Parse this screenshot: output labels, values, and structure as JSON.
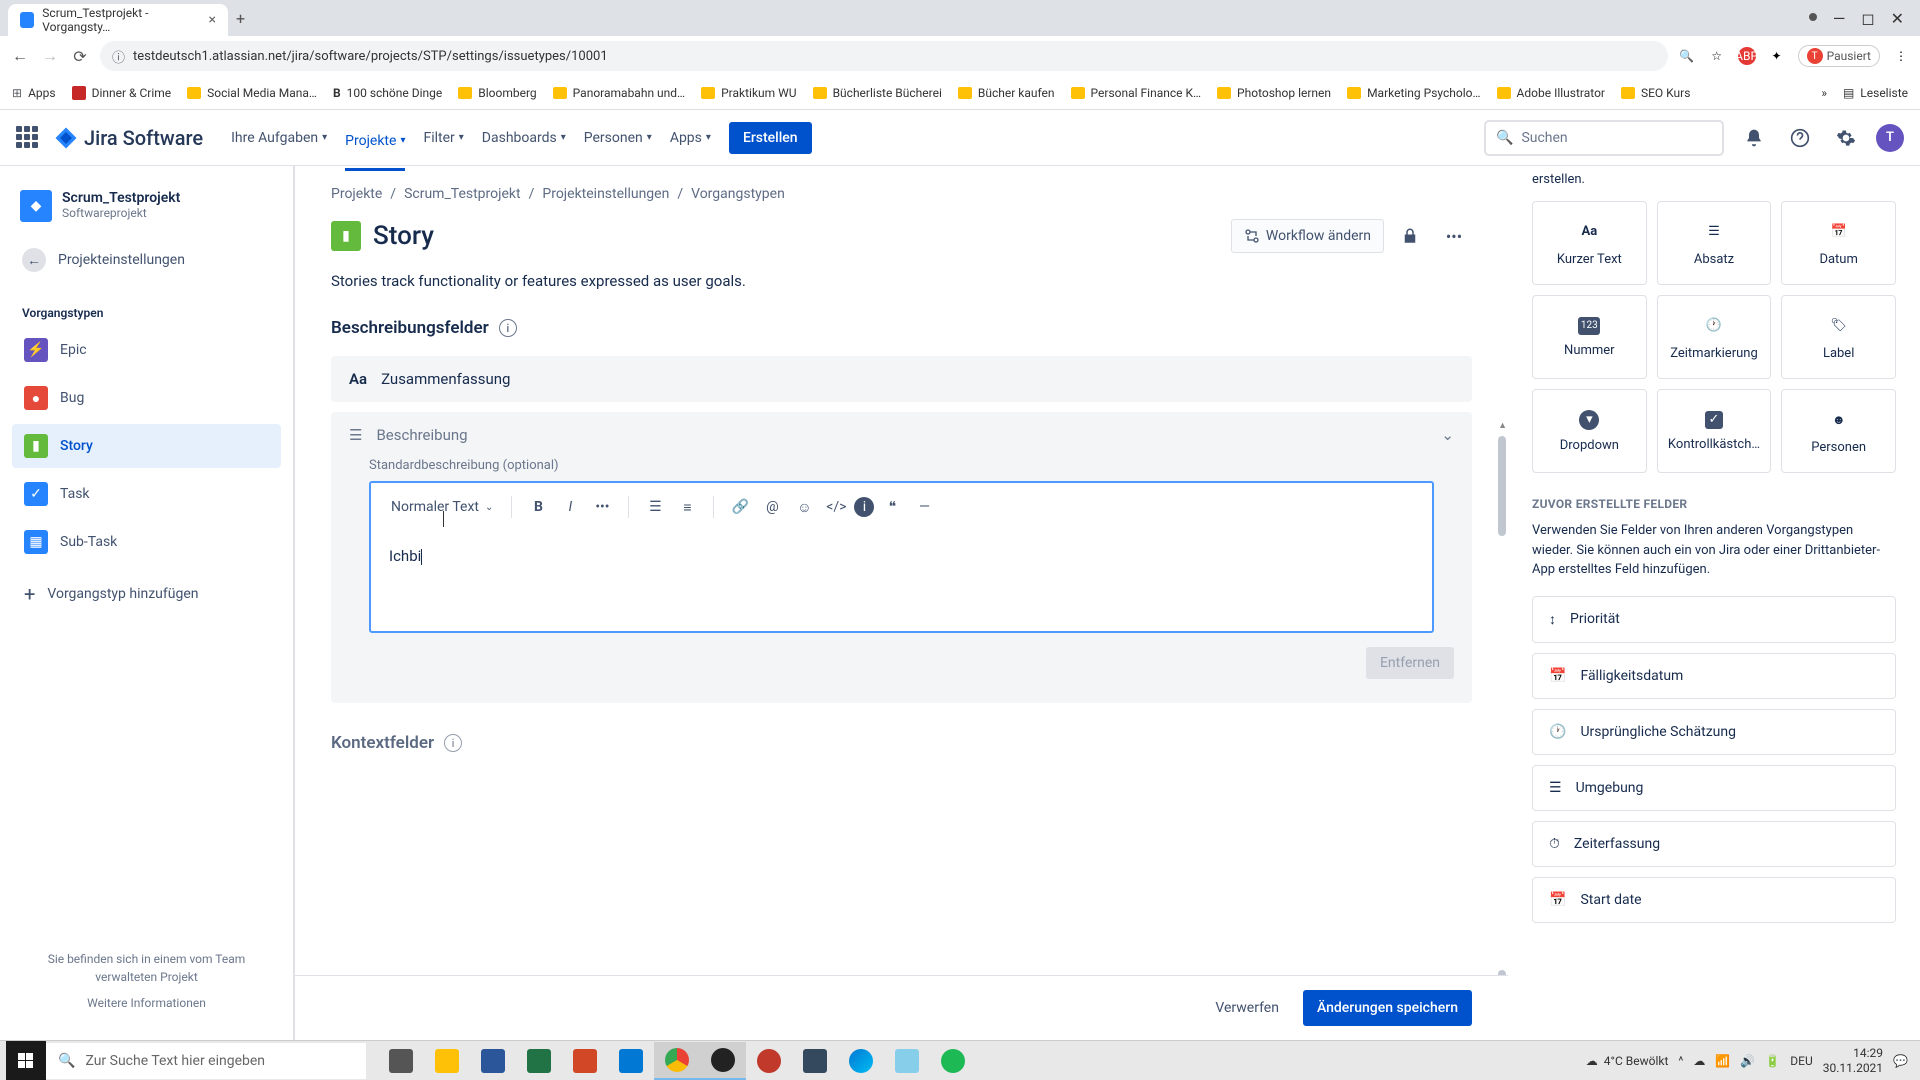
{
  "browser": {
    "tab_title": "Scrum_Testprojekt - Vorgangsty…",
    "url": "testdeutsch1.atlassian.net/jira/software/projects/STP/settings/issuetypes/10001",
    "pausiert": "Pausiert",
    "bookmarks": [
      "Apps",
      "Dinner & Crime",
      "Social Media Mana…",
      "100 schöne Dinge",
      "Bloomberg",
      "Panoramabahn und…",
      "Praktikum WU",
      "Bücherliste Bücherei",
      "Bücher kaufen",
      "Personal Finance K…",
      "Photoshop lernen",
      "Marketing Psycholo…",
      "Adobe Illustrator",
      "SEO Kurs"
    ],
    "reading_list": "Leseliste"
  },
  "nav": {
    "product": "Jira Software",
    "items": [
      "Ihre Aufgaben",
      "Projekte",
      "Filter",
      "Dashboards",
      "Personen",
      "Apps"
    ],
    "create": "Erstellen",
    "search_placeholder": "Suchen",
    "avatar_initial": "T"
  },
  "sidebar": {
    "project_name": "Scrum_Testprojekt",
    "project_type": "Softwareprojekt",
    "back": "Projekteinstellungen",
    "section": "Vorgangstypen",
    "items": [
      {
        "label": "Epic",
        "color": "ic-epic",
        "glyph": "⚡"
      },
      {
        "label": "Bug",
        "color": "ic-bug",
        "glyph": "●"
      },
      {
        "label": "Story",
        "color": "ic-story",
        "glyph": "▮"
      },
      {
        "label": "Task",
        "color": "ic-task",
        "glyph": "✓"
      },
      {
        "label": "Sub-Task",
        "color": "ic-sub",
        "glyph": "▦"
      }
    ],
    "add": "Vorgangstyp hinzufügen",
    "footer1": "Sie befinden sich in einem vom Team verwalteten Projekt",
    "footer2": "Weitere Informationen"
  },
  "breadcrumb": [
    "Projekte",
    "Scrum_Testprojekt",
    "Projekteinstellungen",
    "Vorgangstypen"
  ],
  "page": {
    "title": "Story",
    "workflow_btn": "Workflow ändern",
    "description": "Stories track functionality or features expressed as user goals.",
    "section_desc": "Beschreibungsfelder",
    "field_summary": "Zusammenfassung",
    "field_description": "Beschreibung",
    "default_desc_label": "Standardbeschreibung (optional)",
    "editor_heading": "Normaler Text",
    "editor_content": "Ichbi",
    "remove_btn": "Entfernen",
    "context_section": "Kontextfelder",
    "discard": "Verwerfen",
    "save": "Änderungen speichern"
  },
  "right_panel": {
    "note_tail": "erstellen.",
    "field_types": [
      "Kurzer Text",
      "Absatz",
      "Datum",
      "Nummer",
      "Zeitmarkierung",
      "Label",
      "Dropdown",
      "Kontrollkästch…",
      "Personen"
    ],
    "prev_label": "ZUVOR ERSTELLTE FELDER",
    "prev_desc": "Verwenden Sie Felder von Ihren anderen Vorgangstypen wieder. Sie können auch ein von Jira oder einer Drittanbieter-App erstelltes Feld hinzufügen.",
    "prev_fields": [
      "Priorität",
      "Fälligkeitsdatum",
      "Ursprüngliche Schätzung",
      "Umgebung",
      "Zeiterfassung",
      "Start date"
    ]
  },
  "taskbar": {
    "search_placeholder": "Zur Suche Text hier eingeben",
    "weather": "4°C Bewölkt",
    "lang": "DEU",
    "time": "14:29",
    "date": "30.11.2021"
  }
}
